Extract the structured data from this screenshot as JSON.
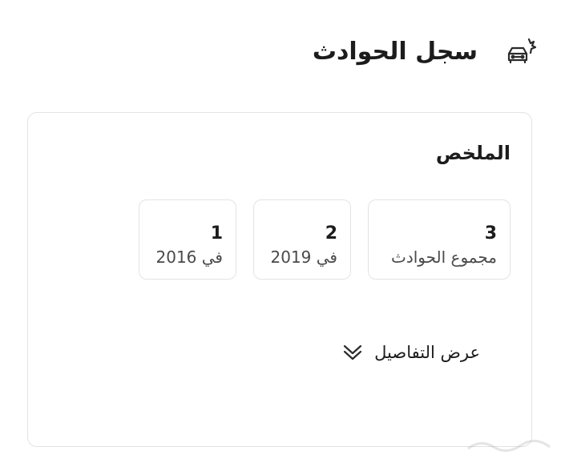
{
  "header": {
    "title": "سجل الحوادث",
    "icon": "car-crash-icon"
  },
  "summary": {
    "title": "الملخص",
    "stats": [
      {
        "value": "3",
        "label": "مجموع الحوادث"
      },
      {
        "value": "2",
        "label": "في 2019"
      },
      {
        "value": "1",
        "label": "في 2016"
      }
    ],
    "details_toggle": {
      "label": "عرض التفاصيل",
      "icon": "double-chevron-down-icon"
    }
  },
  "colors": {
    "border": "#e3e3e3",
    "text": "#1c1c1c",
    "muted_text": "#4a4a4a"
  }
}
